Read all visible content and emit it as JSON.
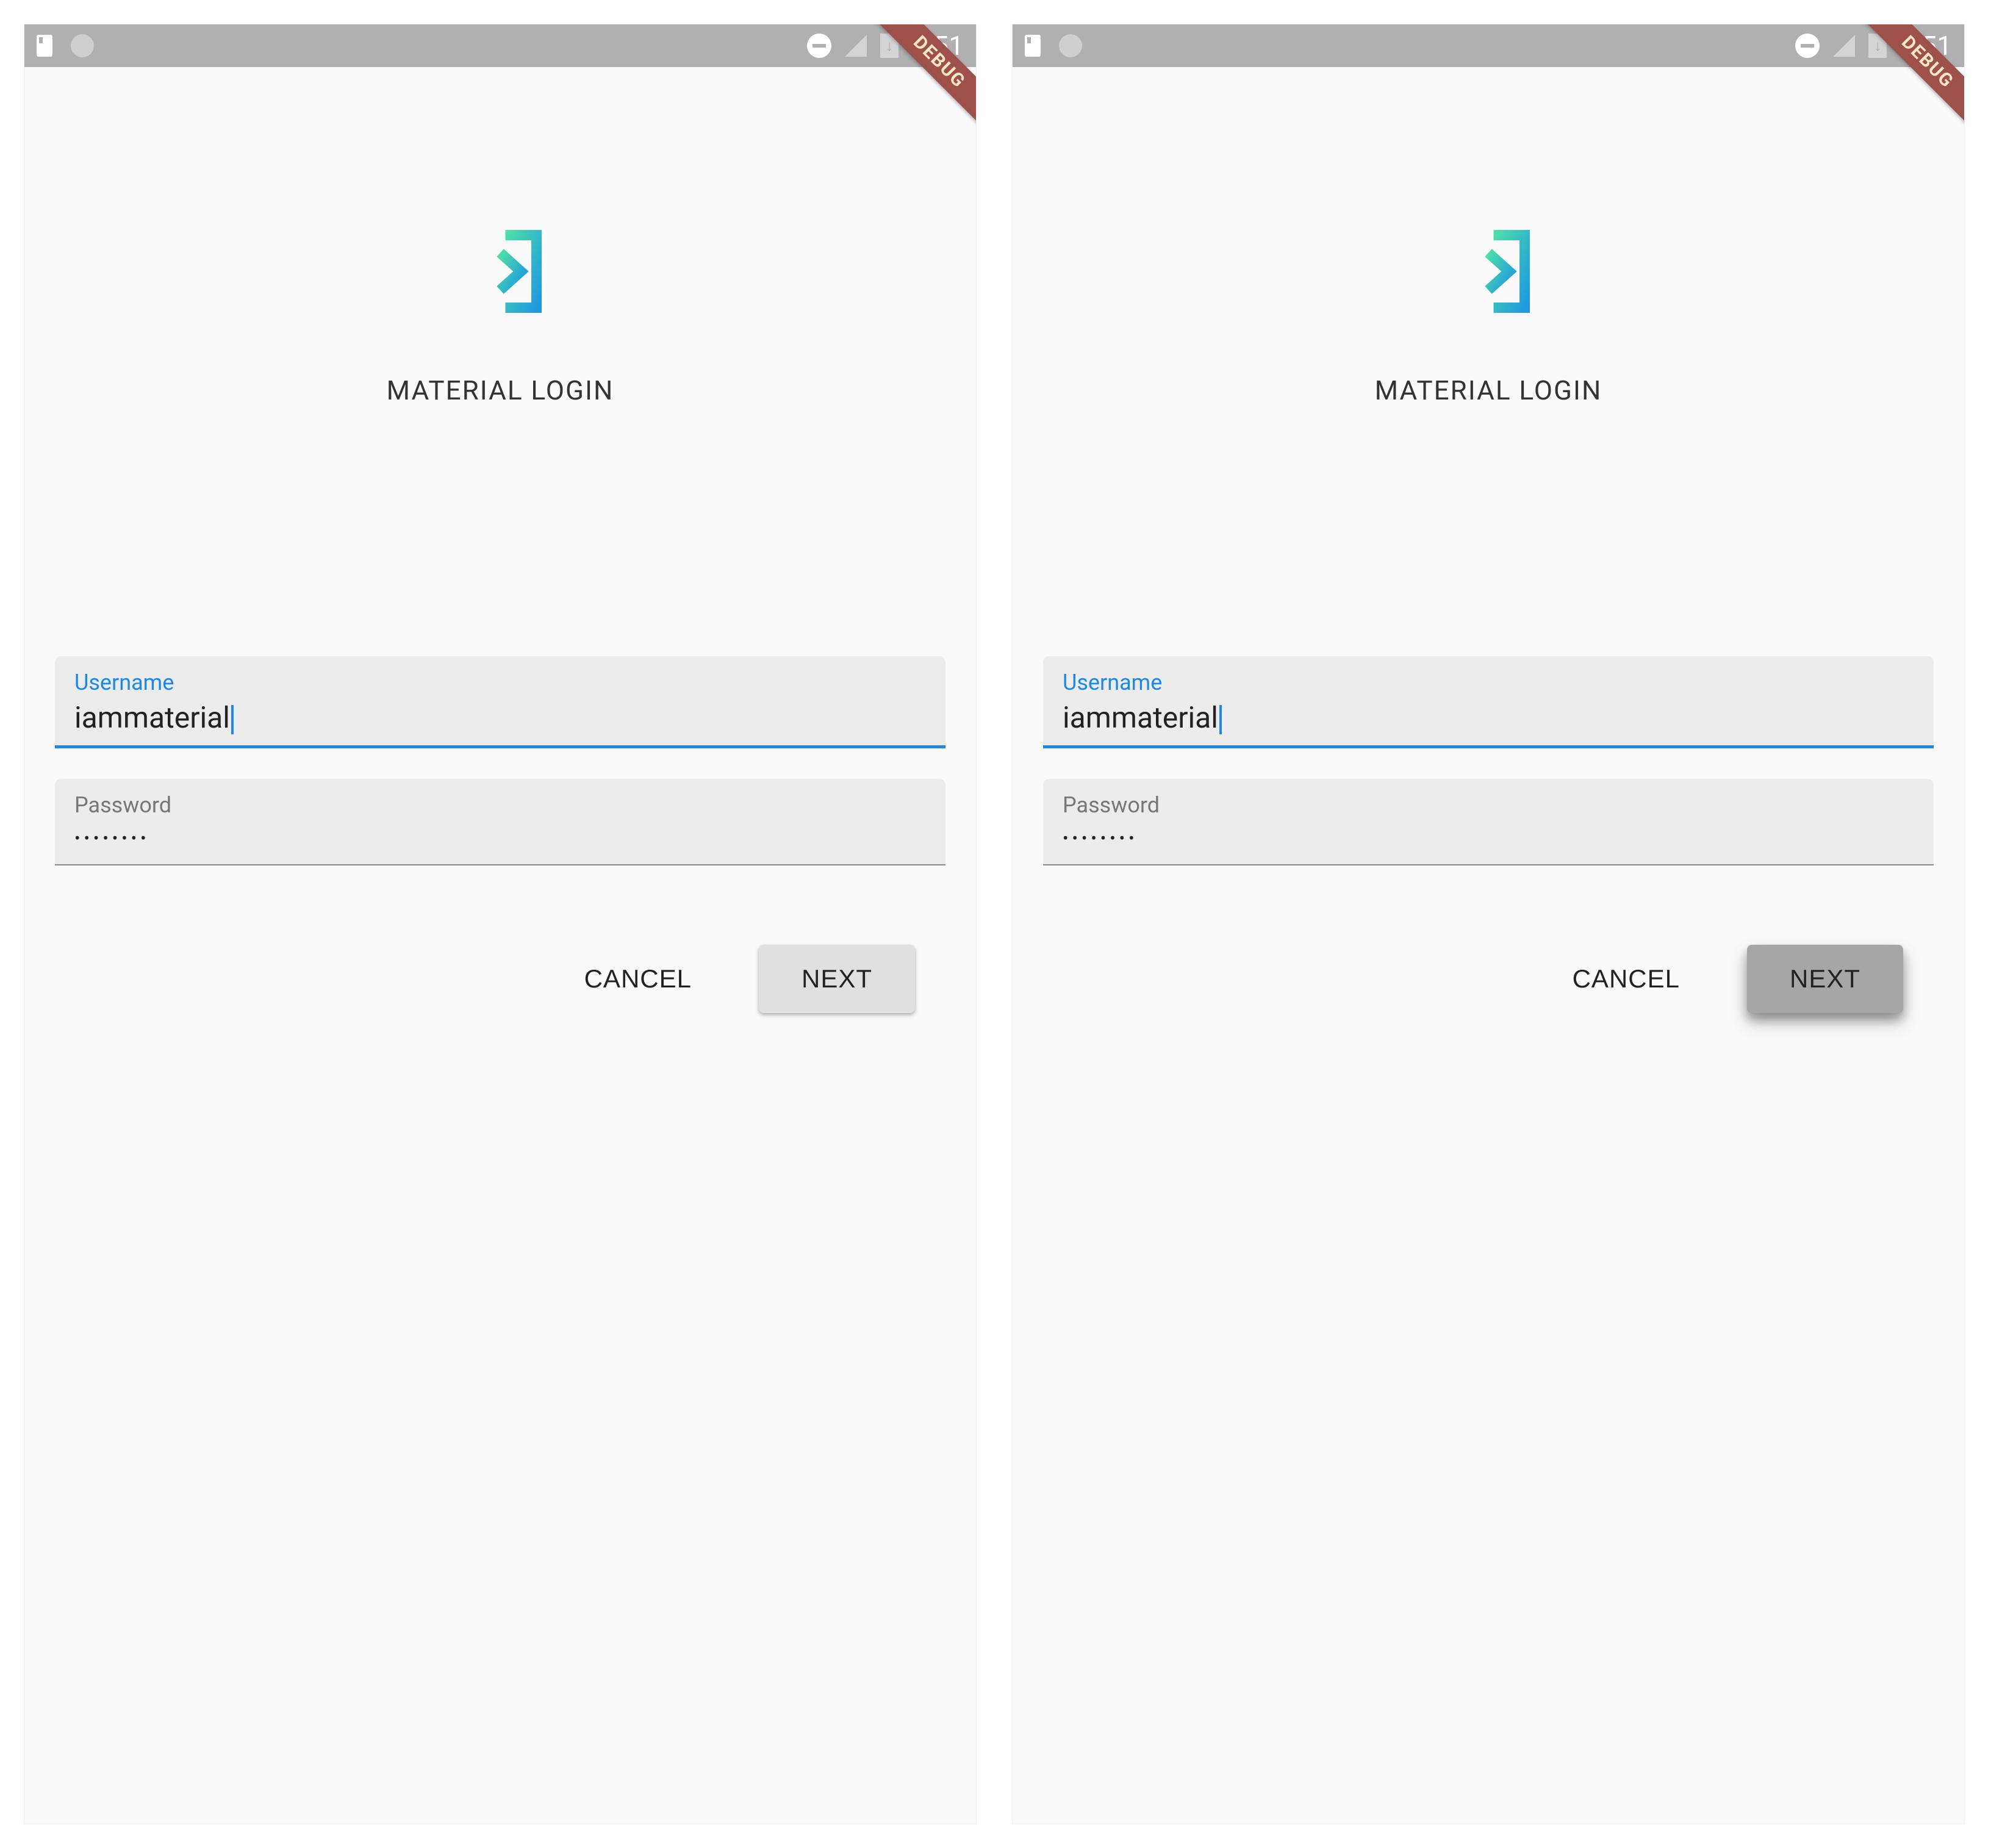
{
  "status": {
    "time": "8:51"
  },
  "debug_label": "DEBUG",
  "app_title": "MATERIAL LOGIN",
  "fields": {
    "username": {
      "label": "Username",
      "value": "iammaterial"
    },
    "password": {
      "label": "Password",
      "value": "••••••••"
    }
  },
  "buttons": {
    "cancel": "CANCEL",
    "next": "NEXT"
  },
  "screens": {
    "left": {
      "next_pressed": false
    },
    "right": {
      "next_pressed": true
    }
  }
}
